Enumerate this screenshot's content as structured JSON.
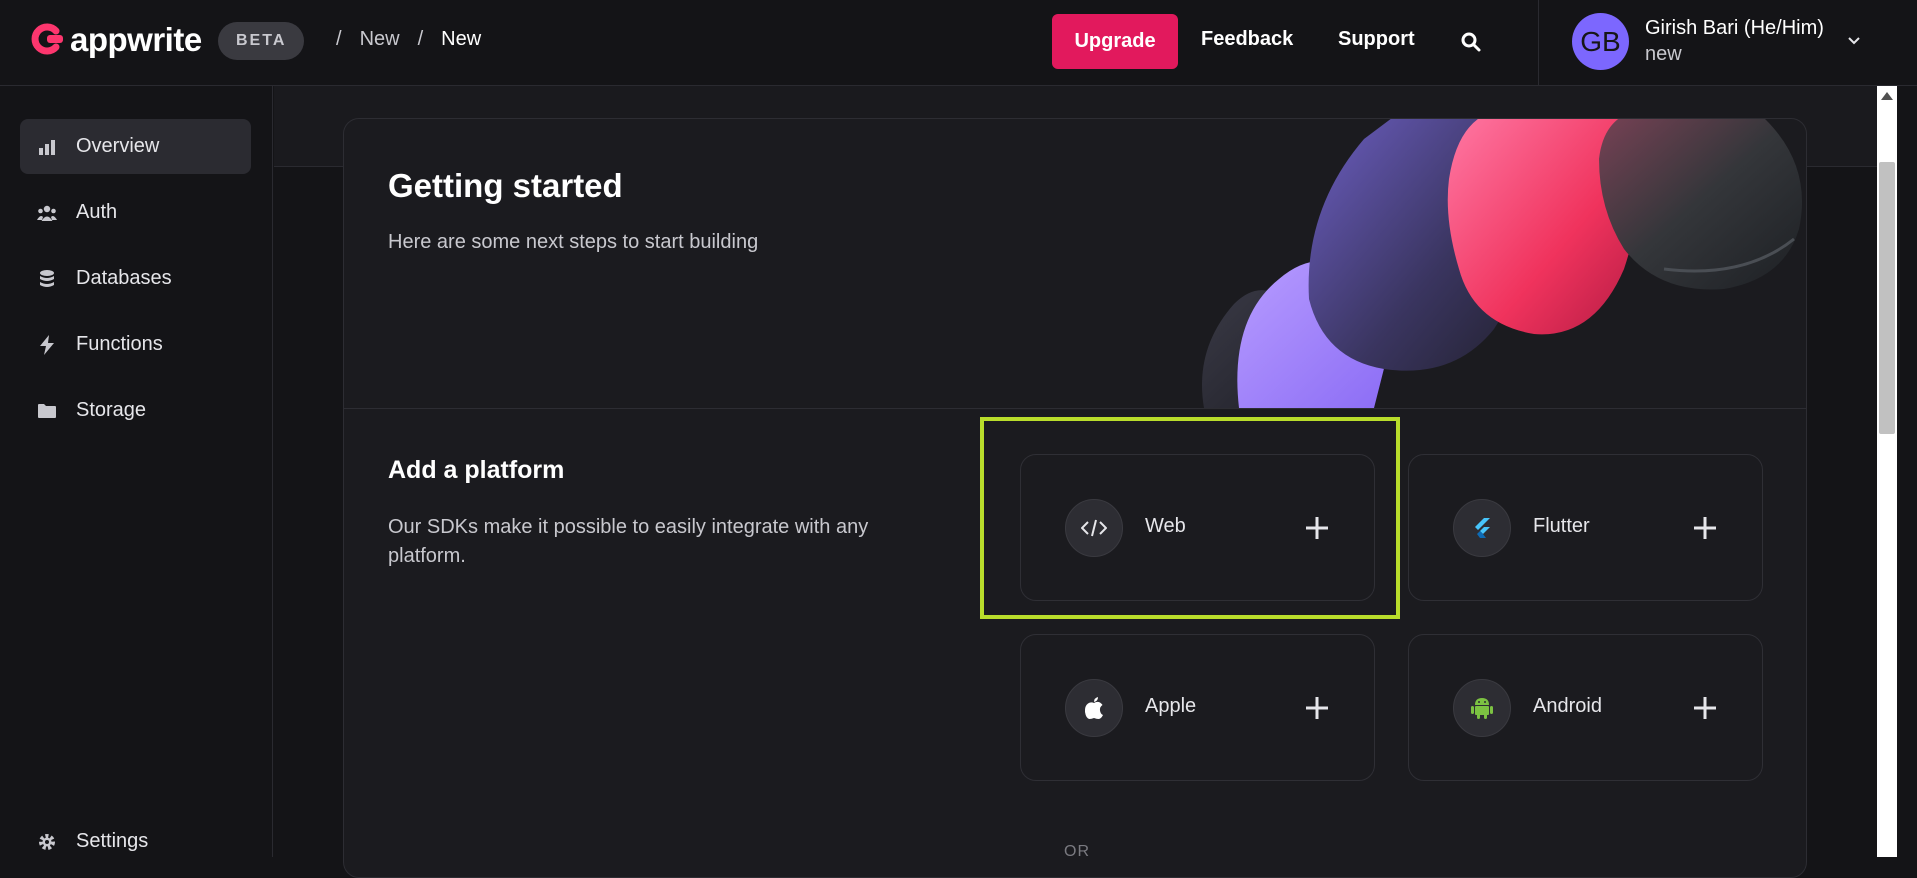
{
  "header": {
    "brand": "appwrite",
    "beta": "BETA",
    "breadcrumbs": [
      {
        "sep": "/",
        "label": "New"
      },
      {
        "sep": "/",
        "label": "New"
      }
    ],
    "upgrade": "Upgrade",
    "feedback": "Feedback",
    "support": "Support",
    "search_icon": "search-icon",
    "user": {
      "initials": "GB",
      "name": "Girish Bari (He/Him)",
      "org": "new"
    }
  },
  "sidebar": {
    "items": [
      {
        "label": "Overview",
        "icon": "bar-chart-icon",
        "active": true
      },
      {
        "label": "Auth",
        "icon": "users-icon"
      },
      {
        "label": "Databases",
        "icon": "database-icon"
      },
      {
        "label": "Functions",
        "icon": "bolt-icon"
      },
      {
        "label": "Storage",
        "icon": "folder-icon"
      }
    ],
    "settings": "Settings"
  },
  "main": {
    "getting_started": {
      "title": "Getting started",
      "subtitle": "Here are some next steps to start building"
    },
    "platform": {
      "title": "Add a platform",
      "description": "Our SDKs make it possible to easily integrate with any platform.",
      "options": [
        {
          "label": "Web",
          "icon": "code-icon"
        },
        {
          "label": "Flutter",
          "icon": "flutter-icon"
        },
        {
          "label": "Apple",
          "icon": "apple-icon"
        },
        {
          "label": "Android",
          "icon": "android-icon"
        }
      ],
      "or": "OR"
    }
  },
  "colors": {
    "accent": "#e2195d",
    "avatar": "#7c67fe",
    "highlight": "#b9dd2b",
    "background": "#141417"
  }
}
